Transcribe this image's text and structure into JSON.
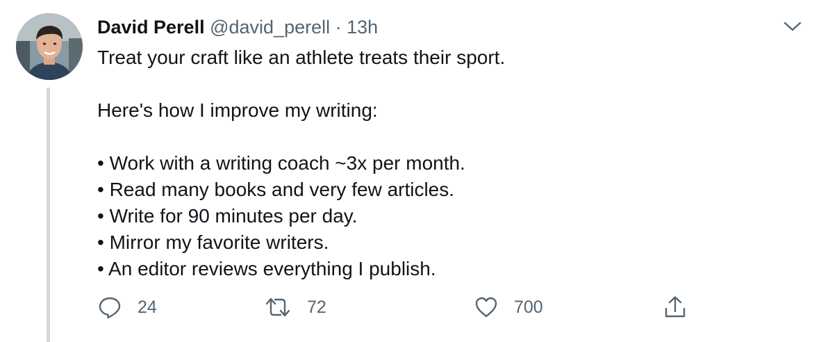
{
  "tweet": {
    "author_name": "David Perell",
    "handle": "@david_perell",
    "separator": " · ",
    "time": "13h",
    "lines": [
      "Treat your craft like an athlete treats their sport.",
      "",
      "Here's how I improve my writing:",
      "",
      "• Work with a writing coach ~3x per month.",
      "• Read many books and very few articles.",
      "• Write for 90 minutes per day.",
      "• Mirror my favorite writers.",
      "• An editor reviews everything I publish."
    ]
  },
  "actions": {
    "replies": "24",
    "retweets": "72",
    "likes": "700"
  },
  "icons": {
    "more": "chevron-down-icon",
    "reply": "speech-bubble-icon",
    "retweet": "retweet-arrows-icon",
    "like": "heart-icon",
    "share": "share-upload-icon"
  },
  "colors": {
    "text": "#0f1419",
    "secondary": "#536471",
    "thread_line": "#cfd9de"
  }
}
